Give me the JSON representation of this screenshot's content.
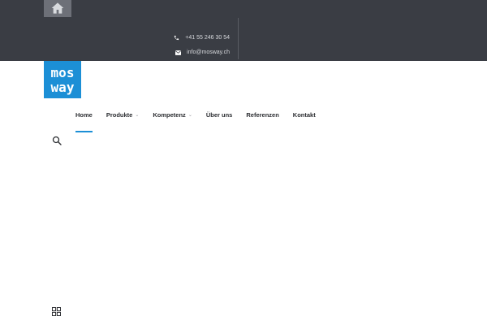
{
  "topbar": {
    "home_icon": "home-icon",
    "phone": {
      "icon": "phone-icon",
      "text": "+41 55 246 30 54"
    },
    "email": {
      "icon": "envelope-icon",
      "text": "info@mosway.ch"
    }
  },
  "logo": {
    "line1": "mos",
    "line2": "way",
    "color": "#1c8fd6"
  },
  "nav": {
    "items": [
      {
        "label": "Home"
      },
      {
        "label": "Produkte"
      },
      {
        "label": "Kompetenz"
      },
      {
        "label": "Über uns"
      },
      {
        "label": "Referenzen"
      },
      {
        "label": "Kontakt"
      }
    ],
    "active_index": 0,
    "caret": "⌄",
    "accent": "#1c8fd6"
  },
  "icons": {
    "search": "search-icon",
    "grid": "grid-icon"
  }
}
